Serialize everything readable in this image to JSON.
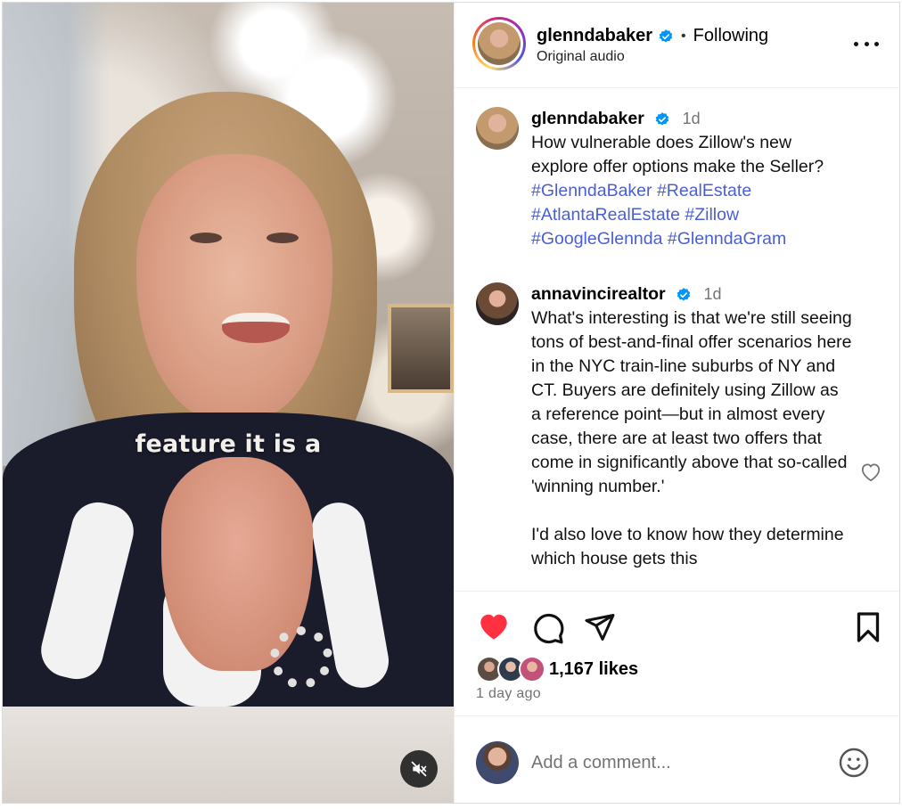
{
  "video": {
    "caption": "feature it is a",
    "mute_icon": "speaker-muted-icon"
  },
  "post": {
    "author": "glenndabaker",
    "follow_separator": "•",
    "follow_state": "Following",
    "audio": "Original audio",
    "more_icon": "more-horizontal-icon"
  },
  "comments": [
    {
      "username": "glenndabaker",
      "verified": true,
      "age": "1d",
      "text": "How vulnerable does Zillow's new explore offer options make the Seller?",
      "hashtags": [
        "#GlenndaBaker",
        "#RealEstate",
        "#AtlantaRealEstate",
        "#Zillow",
        "#GoogleGlennda",
        "#GlenndaGram"
      ]
    },
    {
      "username": "annavincirealtor",
      "verified": true,
      "age": "1d",
      "text": "What's interesting is that we're still seeing tons of best-and-final offer scenarios here in the NYC train-line suburbs of NY and CT. Buyers are definitely using Zillow as a reference point—but in almost every case, there are at least two offers that come in significantly above that so-called 'winning number.'\n\nI'd also love to know how they determine which house gets this"
    }
  ],
  "actions": {
    "like_icon": "heart-filled-icon",
    "comment_icon": "comment-icon",
    "share_icon": "share-paper-plane-icon",
    "save_icon": "bookmark-icon",
    "likes_count": "1,167 likes",
    "timestamp": "1 day ago"
  },
  "composer": {
    "placeholder": "Add a comment...",
    "emoji_icon": "emoji-smile-icon"
  },
  "colors": {
    "like_red": "#ff3040",
    "hashtag_blue": "#4a5fd3",
    "verified_blue": "#0095f6",
    "muted_text": "#737373"
  }
}
